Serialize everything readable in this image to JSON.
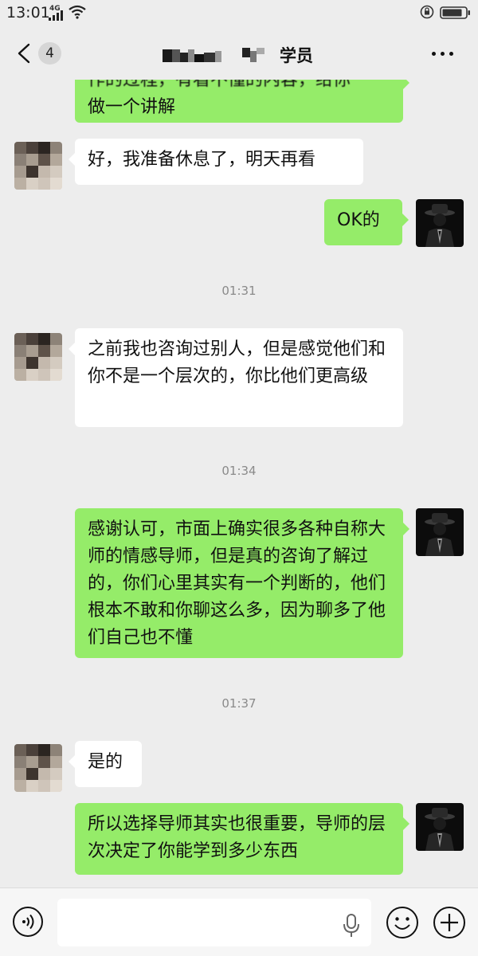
{
  "status_bar": {
    "time": "13:01",
    "network": "4G",
    "icons": [
      "signal-icon",
      "wifi-icon",
      "alarm-icon",
      "battery-icon"
    ]
  },
  "header": {
    "unread_count": "4",
    "title": "学员",
    "title_note_obscured": true,
    "icons": [
      "back-chevron-icon",
      "more-icon"
    ]
  },
  "colors": {
    "background": "#ededed",
    "outgoing_bubble": "#95ec69",
    "incoming_bubble": "#ffffff",
    "timestamp_text": "#8a8a8a"
  },
  "messages": [
    {
      "id": "m0",
      "direction": "out",
      "text": "做一个讲解",
      "partial_top_text": "作的过程，有看不懂的内容，给你"
    },
    {
      "id": "m1",
      "direction": "in",
      "text": "好，我准备休息了，明天再看"
    },
    {
      "id": "m2",
      "direction": "out",
      "text": "OK的"
    },
    {
      "id": "t1",
      "type": "timestamp",
      "text": "01:31"
    },
    {
      "id": "m3",
      "direction": "in",
      "text": "之前我也咨询过别人，但是感觉他们和你不是一个层次的，你比他们更高级"
    },
    {
      "id": "t2",
      "type": "timestamp",
      "text": "01:34"
    },
    {
      "id": "m4",
      "direction": "out",
      "text": "感谢认可，市面上确实很多各种自称大师的情感导师，但是真的咨询了解过的，你们心里其实有一个判断的，他们根本不敢和你聊这么多，因为聊多了他们自己也不懂"
    },
    {
      "id": "t3",
      "type": "timestamp",
      "text": "01:37"
    },
    {
      "id": "m5",
      "direction": "in",
      "text": "是的"
    },
    {
      "id": "m6",
      "direction": "out",
      "text": "所以选择导师其实也很重要，导师的层次决定了你能学到多少东西"
    }
  ],
  "input_bar": {
    "placeholder": "",
    "icons": [
      "voice-icon",
      "mic-icon",
      "emoji-icon",
      "plus-icon"
    ]
  }
}
